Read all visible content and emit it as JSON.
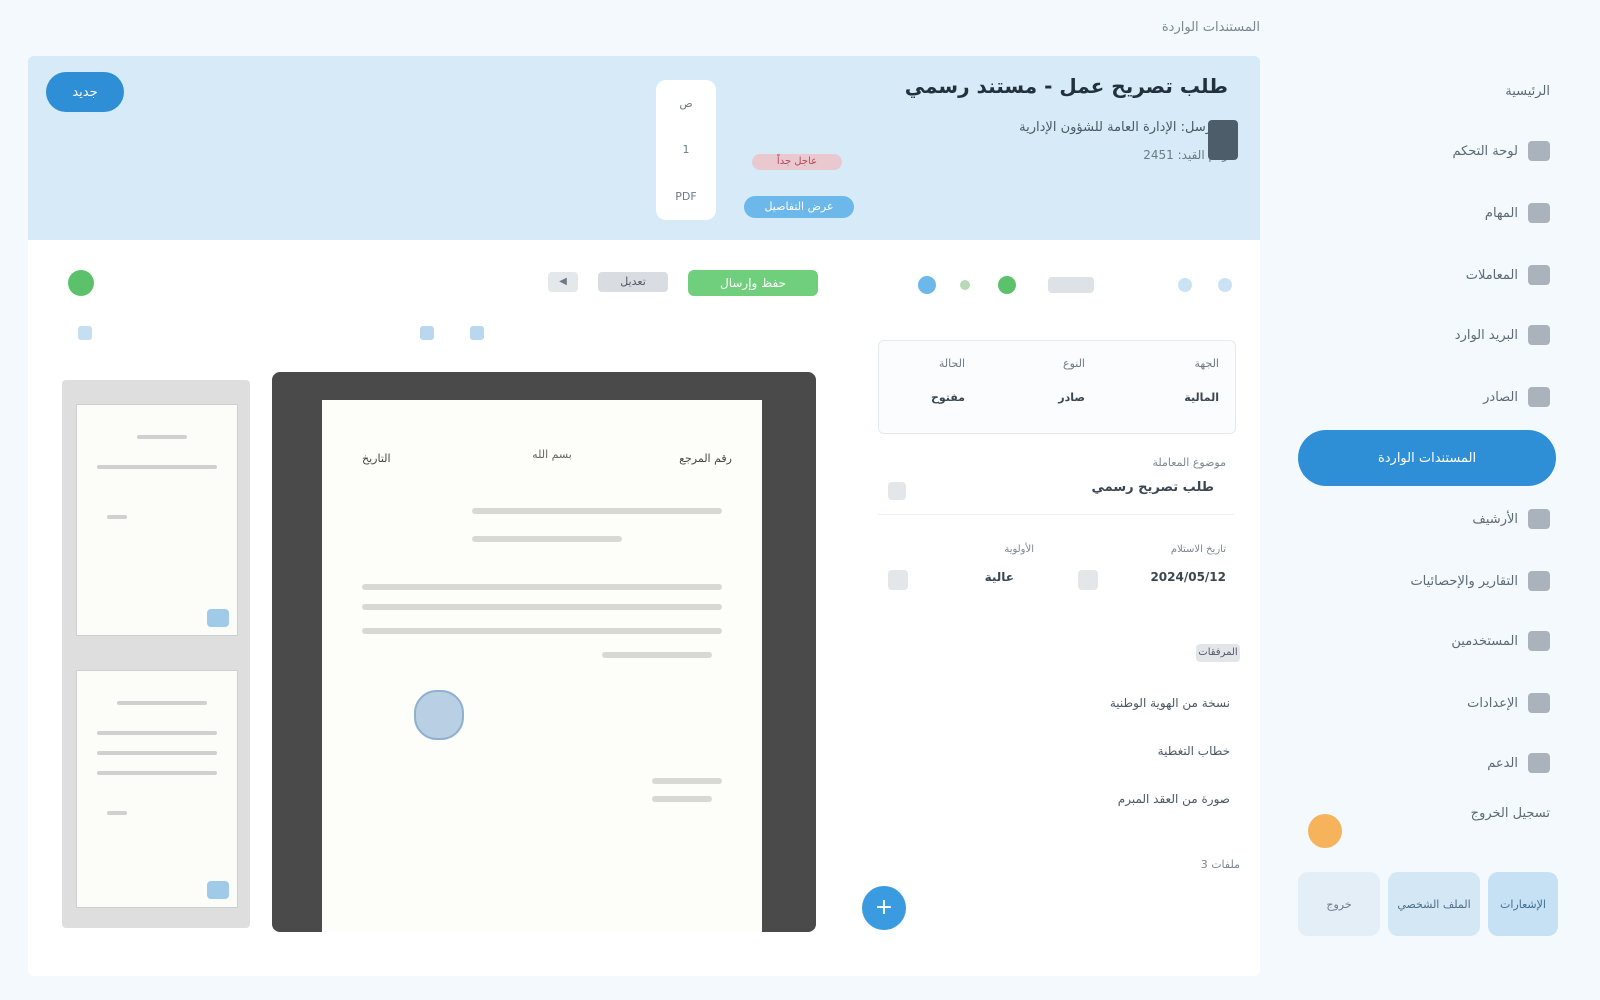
{
  "header": {
    "title": "المستندات الواردة"
  },
  "banner": {
    "badge": "جديد",
    "title": "طلب تصريح عمل - مستند رسمي",
    "subtitle": "المرسل: الإدارة العامة للشؤون الإدارية",
    "subtitle2": "رقم القيد: 2451",
    "card": [
      "ص",
      "1",
      "PDF"
    ],
    "status": "عاجل جداً",
    "link": "عرض التفاصيل"
  },
  "toolbar": {
    "save": "حفظ وإرسال",
    "btn_a": "◀",
    "btn_b": "تعديل"
  },
  "document": {
    "head_left": "التاريخ",
    "head_center": "بسم الله",
    "head_right": "رقم المرجع"
  },
  "details": {
    "table": {
      "col1_label": "الجهة",
      "col1_value": "المالية",
      "col2_label": "النوع",
      "col2_value": "صادر",
      "col3_label": "الحالة",
      "col3_value": "مفتوح"
    },
    "field1_label": "موضوع المعاملة",
    "field1_value": "طلب تصريح رسمي",
    "row": {
      "a_label": "تاريخ الاستلام",
      "a_value": "2024/05/12",
      "b_label": "الأولوية",
      "b_value": "عالية"
    },
    "section": "المرفقات",
    "list": [
      "نسخة من الهوية الوطنية",
      "خطاب التغطية",
      "صورة من العقد المبرم"
    ],
    "note": "3 ملفات",
    "fab": "+"
  },
  "sidebar": {
    "items": [
      "الرئيسية",
      "لوحة التحكم",
      "المهام",
      "المعاملات",
      "البريد الوارد",
      "الصادر",
      "المستندات الواردة",
      "الأرشيف",
      "التقارير والإحصائيات",
      "المستخدمين",
      "الإعدادات",
      "الدعم",
      "تسجيل الخروج"
    ],
    "bottom": [
      "خروج",
      "الملف الشخصي",
      "الإشعارات"
    ]
  }
}
